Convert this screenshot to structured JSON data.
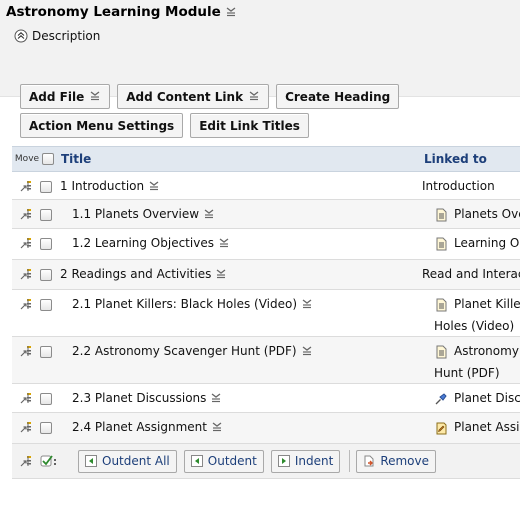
{
  "header": {
    "title": "Astronomy Learning Module",
    "description_label": "Description"
  },
  "toolbar": {
    "add_file": "Add File",
    "add_content_link": "Add Content Link",
    "create_heading": "Create Heading",
    "action_menu_settings": "Action Menu Settings",
    "edit_link_titles": "Edit Link Titles"
  },
  "table": {
    "col_move": "Move",
    "col_title": "Title",
    "col_linked": "Linked to",
    "rows": [
      {
        "title": "1 Introduction",
        "linked": "Introduction",
        "linked_icon": "none",
        "indent": 0
      },
      {
        "title": "1.1 Planets Overview",
        "linked": "Planets Overview",
        "linked_icon": "document-icon",
        "indent": 1
      },
      {
        "title": "1.2 Learning Objectives",
        "linked": "Learning Objectives",
        "linked_icon": "document-icon",
        "indent": 1
      },
      {
        "title": "2 Readings and Activities",
        "linked": "Read and Interact",
        "linked_icon": "none",
        "indent": 0
      },
      {
        "title": "2.1 Planet Killers: Black Holes (Video)",
        "linked_line1": "Planet Killers: Black",
        "linked_line2": "Holes (Video)",
        "linked_icon": "document-icon",
        "indent": 1
      },
      {
        "title": "2.2 Astronomy Scavenger Hunt (PDF)",
        "linked_line1": "Astronomy Scavenger",
        "linked_line2": "Hunt (PDF)",
        "linked_icon": "document-icon",
        "indent": 1
      },
      {
        "title": "2.3 Planet Discussions",
        "linked": "Planet Discussions",
        "linked_icon": "pushpin-icon",
        "indent": 1
      },
      {
        "title": "2.4 Planet Assignment",
        "linked": "Planet Assignment",
        "linked_icon": "assignment-icon",
        "indent": 1
      }
    ]
  },
  "bottom": {
    "outdent_all": "Outdent All",
    "outdent": "Outdent",
    "indent": "Indent",
    "remove": "Remove"
  },
  "colors": {
    "header_bg": "#f2f2f2",
    "table_header_bg": "#e1e8f0",
    "link_text": "#1d3f7a"
  }
}
